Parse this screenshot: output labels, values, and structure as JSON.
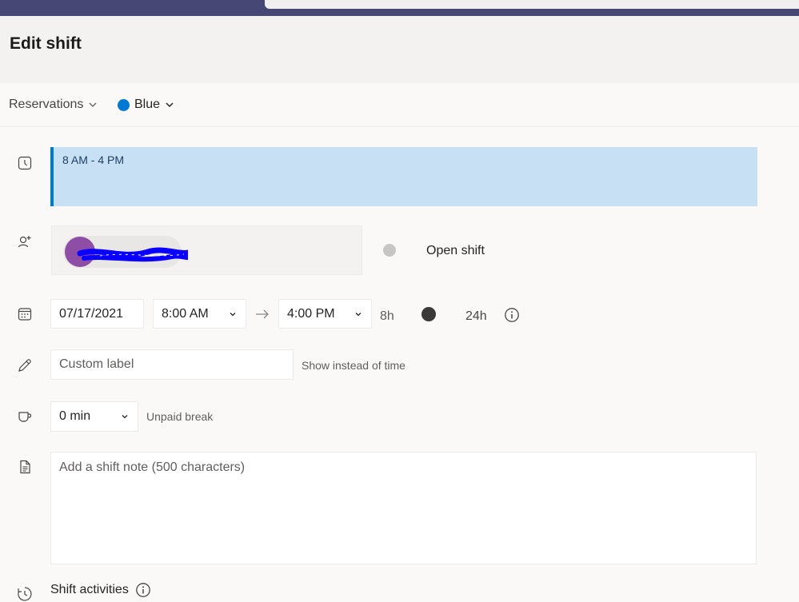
{
  "header": {
    "title": "Edit shift"
  },
  "subbar": {
    "group": "Reservations",
    "color_label": "Blue",
    "color_hex": "#0078d4"
  },
  "shift": {
    "time_range": "8 AM - 4 PM",
    "block_color": "#c7e0f4"
  },
  "member": {
    "open_shift_label": "Open shift",
    "avatar_color": "#8f4ea5"
  },
  "schedule": {
    "date": "07/17/2021",
    "start_time": "8:00 AM",
    "end_time": "4:00 PM",
    "duration": "8h",
    "toggle_24h_label": "24h"
  },
  "custom_label": {
    "placeholder": "Custom label",
    "hint": "Show instead of time"
  },
  "break": {
    "value": "0 min",
    "hint": "Unpaid break"
  },
  "note": {
    "placeholder": "Add a shift note (500 characters)"
  },
  "activities": {
    "label": "Shift activities"
  }
}
